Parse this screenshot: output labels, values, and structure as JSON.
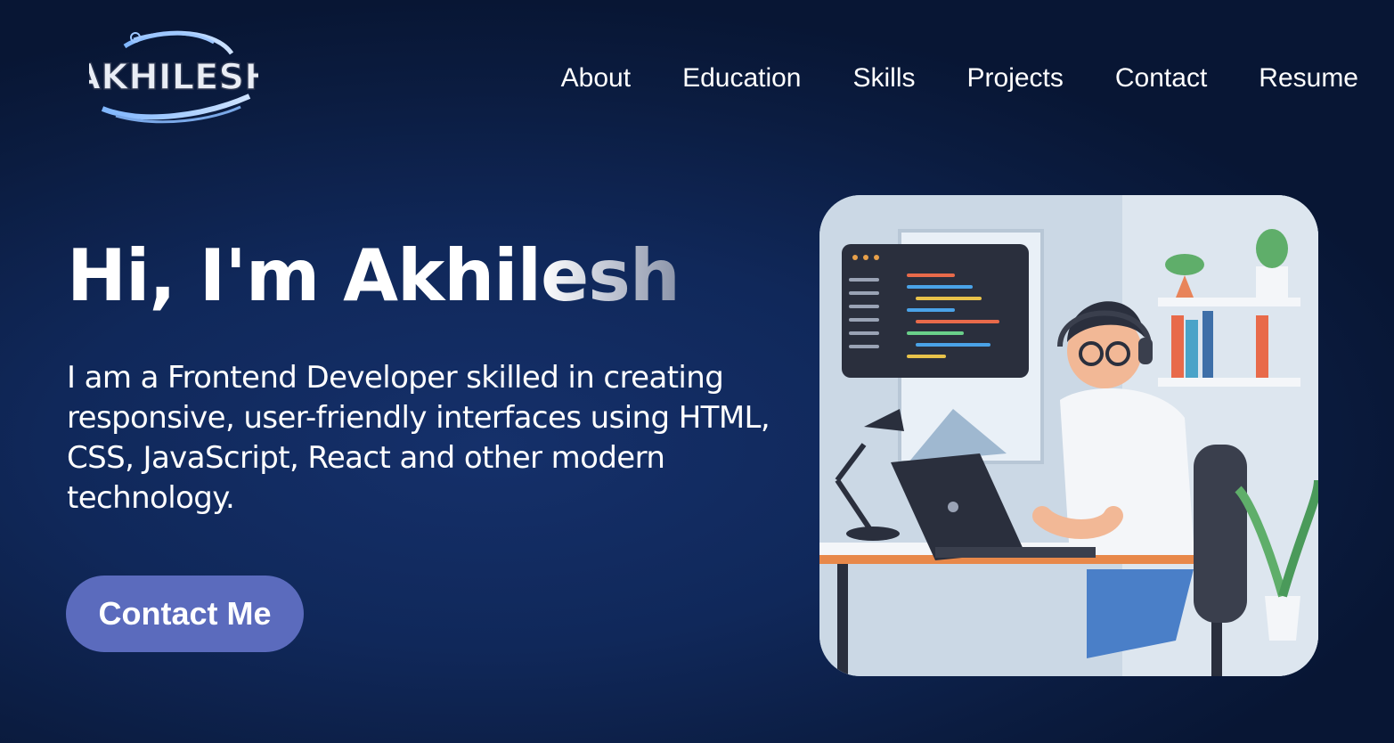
{
  "logo": {
    "text": "AKHILESH"
  },
  "nav": {
    "items": [
      {
        "label": "About"
      },
      {
        "label": "Education"
      },
      {
        "label": "Skills"
      },
      {
        "label": "Projects"
      },
      {
        "label": "Contact"
      },
      {
        "label": "Resume"
      }
    ]
  },
  "hero": {
    "title_main": "Hi, I'm Akhil",
    "title_fade": "esh",
    "description": "I am a Frontend Developer skilled in creating responsive, user-friendly interfaces using HTML, CSS, JavaScript, React and other modern technology.",
    "cta_label": "Contact Me"
  },
  "colors": {
    "background": "#10285a",
    "cta": "#5b6bbd",
    "text": "#ffffff"
  }
}
